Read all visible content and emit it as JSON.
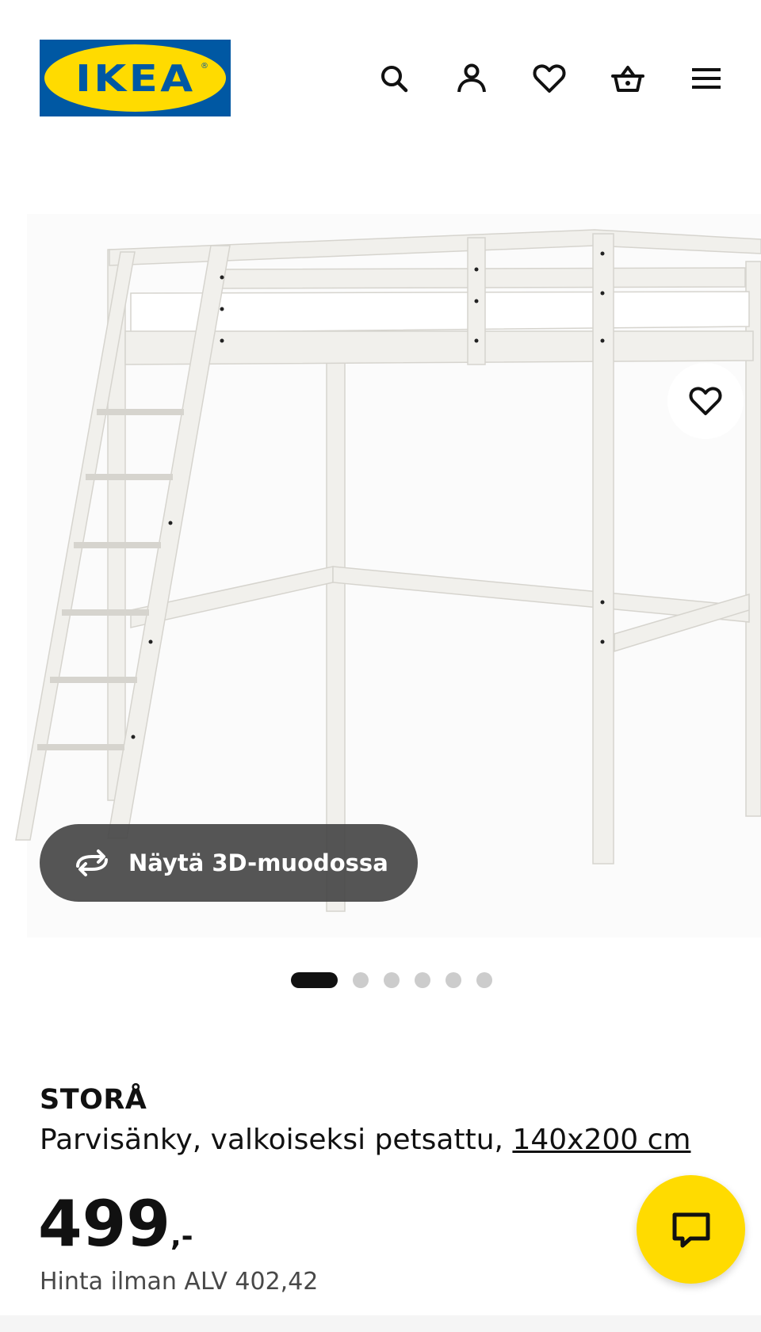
{
  "header": {
    "logo_text": "IKEA",
    "logo_reg": "®",
    "icons": [
      "search-icon",
      "profile-icon",
      "favourites-icon",
      "cart-icon",
      "menu-icon"
    ]
  },
  "gallery": {
    "button_3d_label": "Näytä 3D-muodossa",
    "slide_count": 6,
    "active_slide": 1
  },
  "product": {
    "name": "STORÅ",
    "description": "Parvisänky, valkoiseksi petsattu, ",
    "size": "140x200 cm",
    "price_main": "499",
    "price_suffix": ",-",
    "price_vat": "Hinta ilman ALV 402,42"
  },
  "colors": {
    "brand_blue": "#0058a3",
    "brand_yellow": "#ffdb00",
    "text": "#111111",
    "muted": "#484848"
  }
}
